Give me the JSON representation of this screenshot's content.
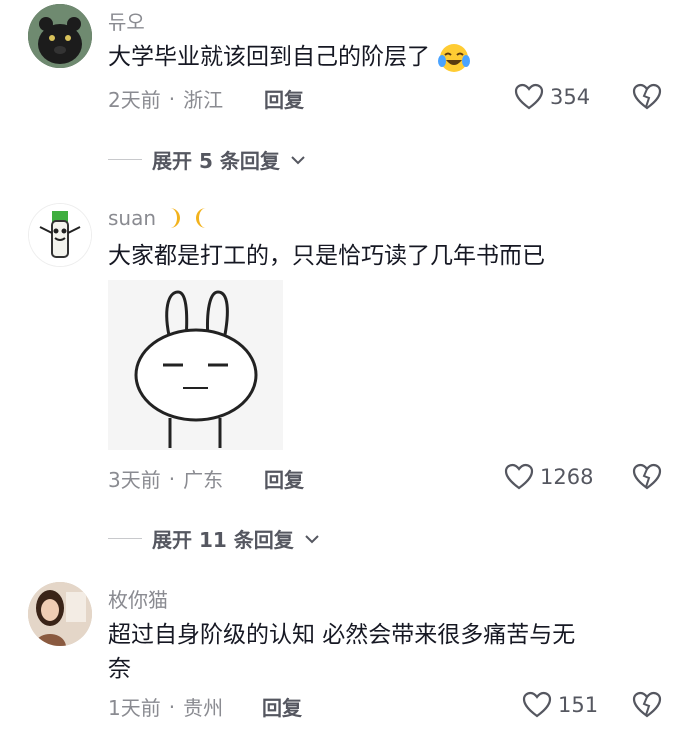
{
  "comments": [
    {
      "username": "듀오",
      "text": "大学毕业就该回到自己的阶层了",
      "emoji": "laughing-tears",
      "time": "2天前",
      "location": "浙江",
      "reply_label": "回复",
      "likes": "354",
      "expand_label": "展开 5 条回复"
    },
    {
      "username": "suan",
      "text": "大家都是打工的，只是恰巧读了几年书而已",
      "time": "3天前",
      "location": "广东",
      "reply_label": "回复",
      "likes": "1268",
      "expand_label": "展开 11 条回复"
    },
    {
      "username": "枚你猫",
      "text_line1": "超过自身阶级的认知 必然会带来很多痛苦与无",
      "text_line2": "奈",
      "time": "1天前",
      "location": "贵州",
      "reply_label": "回复",
      "likes": "151"
    }
  ],
  "separator": "·",
  "colors": {
    "primary_text": "#161823",
    "secondary_text": "#8a8b91",
    "action_text": "#555760"
  }
}
